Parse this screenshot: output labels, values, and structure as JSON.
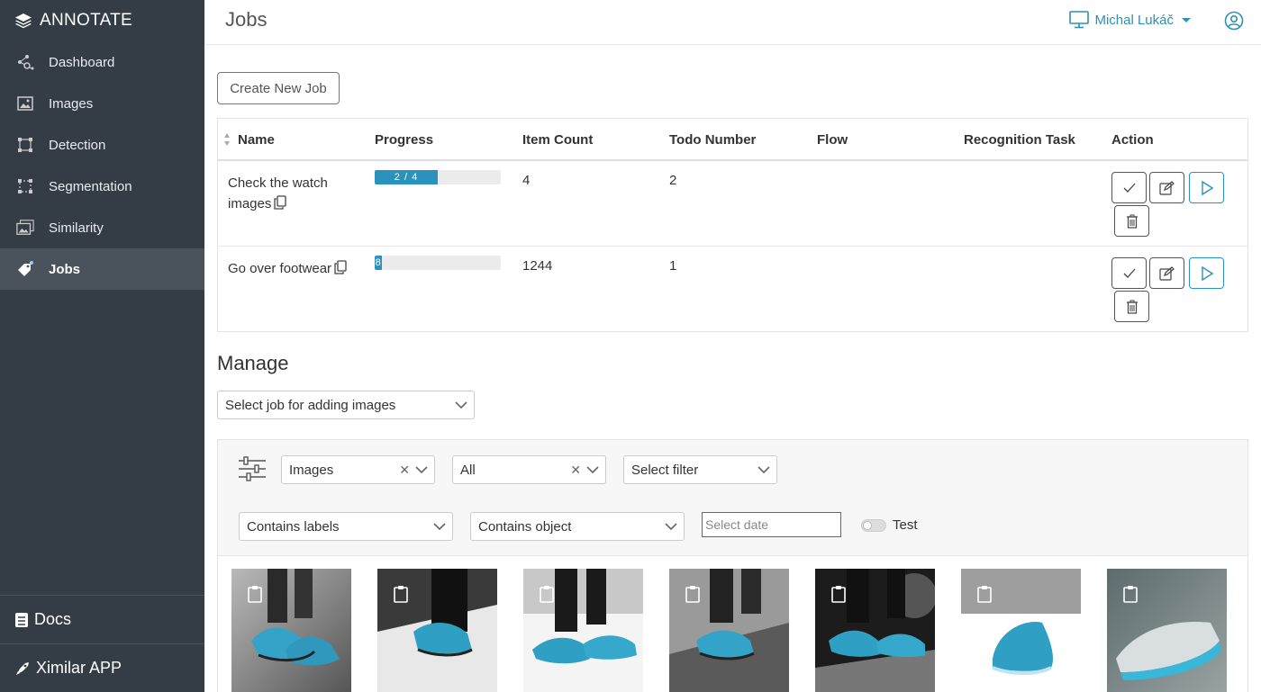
{
  "app": {
    "name": "ANNOTATE"
  },
  "sidebar": {
    "items": [
      {
        "label": "Dashboard",
        "icon": "dashboard-icon"
      },
      {
        "label": "Images",
        "icon": "image-icon"
      },
      {
        "label": "Detection",
        "icon": "detection-icon"
      },
      {
        "label": "Segmentation",
        "icon": "segmentation-icon"
      },
      {
        "label": "Similarity",
        "icon": "similarity-icon"
      },
      {
        "label": "Jobs",
        "icon": "jobs-icon",
        "active": true
      }
    ],
    "bottom": [
      {
        "label": "Docs",
        "icon": "docs-icon"
      },
      {
        "label": "Ximilar APP",
        "icon": "rocket-icon"
      }
    ]
  },
  "header": {
    "title": "Jobs",
    "user_name": "Michal Lukáč"
  },
  "jobs": {
    "create_label": "Create New Job",
    "columns": [
      "Name",
      "Progress",
      "Item Count",
      "Todo Number",
      "Flow",
      "Recognition Task",
      "Action"
    ],
    "rows": [
      {
        "name": "Check the watch images",
        "progress_text": "2 / 4",
        "progress_fraction": 0.5,
        "item_count": "4",
        "todo": "2",
        "flow": "",
        "task": ""
      },
      {
        "name": "Go over footwear",
        "progress_text": "8",
        "progress_fraction": 0.06,
        "item_count": "1244",
        "todo": "1",
        "flow": "",
        "task": ""
      }
    ]
  },
  "manage": {
    "title": "Manage",
    "select_job_placeholder": "Select job for adding images",
    "filters": {
      "type_value": "Images",
      "scope_value": "All",
      "filter_placeholder": "Select filter",
      "labels_placeholder": "Contains labels",
      "object_placeholder": "Contains object",
      "date_placeholder": "Select date",
      "test_label": "Test"
    }
  },
  "gallery": {
    "images": [
      {
        "alt": "sneaker-1"
      },
      {
        "alt": "sneaker-2"
      },
      {
        "alt": "sneaker-3"
      },
      {
        "alt": "sneaker-4"
      },
      {
        "alt": "sneaker-5"
      },
      {
        "alt": "sneaker-6"
      },
      {
        "alt": "sneaker-7"
      }
    ]
  },
  "colors": {
    "sidebar_bg": "#343d46",
    "accent": "#2a92bd",
    "active_bg": "#4a535c"
  }
}
